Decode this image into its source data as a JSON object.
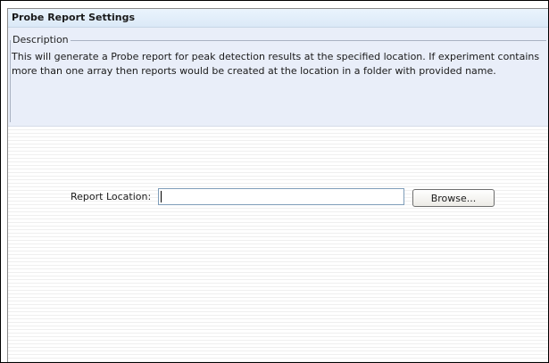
{
  "panel": {
    "title": "Probe Report Settings"
  },
  "description": {
    "legend": "Description",
    "text": "This will generate a Probe report for peak detection results at the specified location. If experiment contains more than one array then reports would be created at the location in a folder with provided name."
  },
  "form": {
    "report_location_label": "Report Location:",
    "report_location_value": "",
    "browse_label": "Browse..."
  }
}
